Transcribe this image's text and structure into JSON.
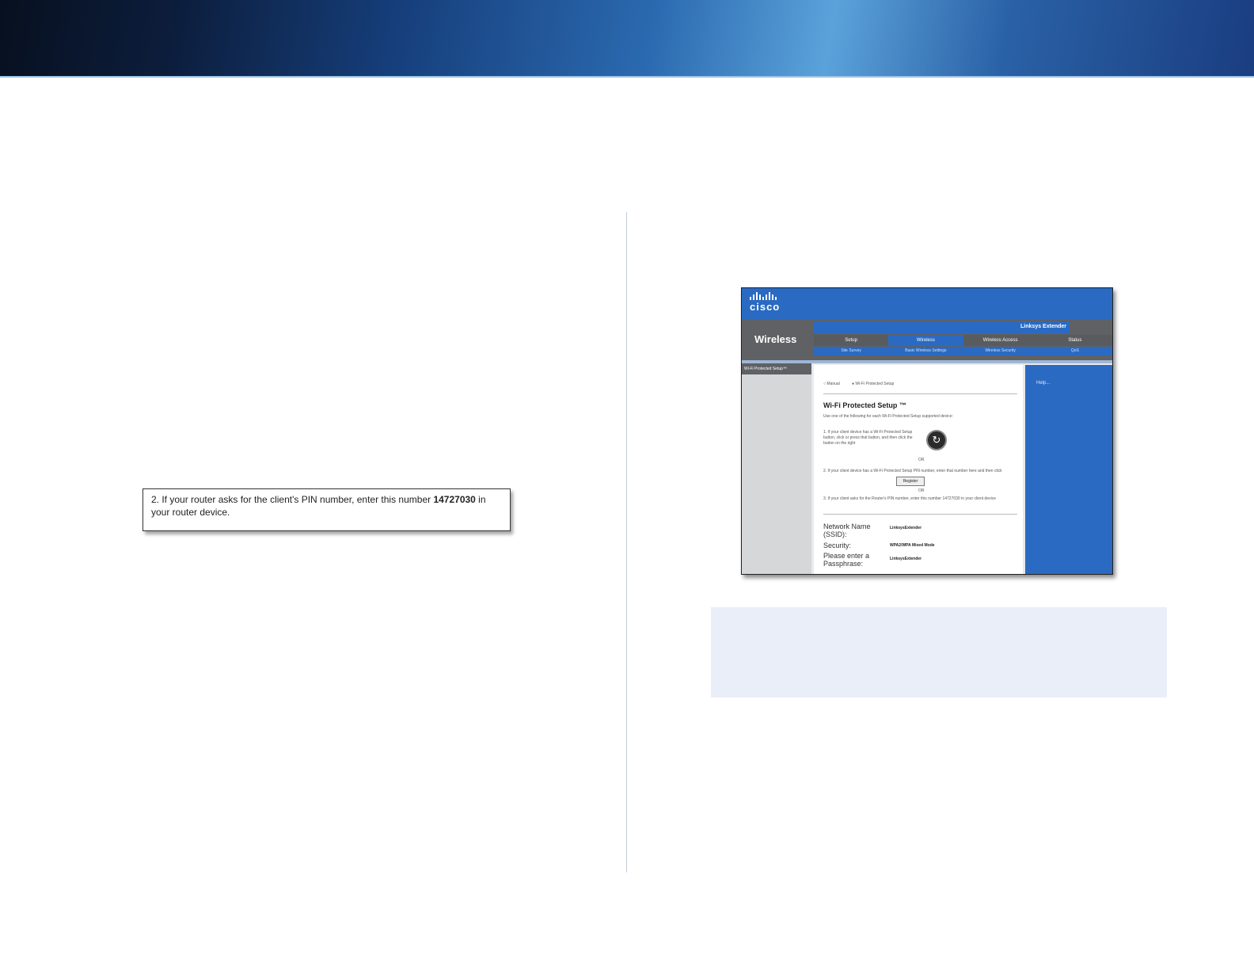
{
  "pin_note": {
    "prefix": "2. If your router asks for the client's PIN number, enter this number ",
    "pin": "14727030",
    "suffix": " in your router device."
  },
  "screenshot": {
    "brand": "cisco",
    "section": "Wireless",
    "product": "Linksys Extender",
    "tabs": [
      "Setup",
      "Wireless",
      "Wireless Access",
      "Status"
    ],
    "subtabs": [
      "Site Survey",
      "Basic Wireless Settings",
      "Wireless Security",
      "QoS"
    ],
    "left_heading": "Wi-Fi Protected Setup™",
    "mode_manual": "Manual",
    "mode_wps": "Wi-Fi Protected Setup",
    "title": "Wi-Fi Protected Setup ™",
    "intro": "Use one of the following for each Wi-Fi Protected Setup supported device:",
    "step1": "1. If your client device has a Wi-Fi Protected Setup button, click or press that button, and then click the button on the right",
    "or": "OR",
    "step2": "2. If your client device has a Wi-Fi Protected Setup PIN number, enter that number here and then click",
    "register_button": "Register",
    "step3": "3. If your client asks for the Router's PIN number, enter this number 14727030 in your client device",
    "fields": [
      {
        "label": "Network Name (SSID):",
        "value": "LinksysExtender"
      },
      {
        "label": "Security:",
        "value": "WPA2/WPA Mixed Mode"
      },
      {
        "label": "Please enter a Passphrase:",
        "value": "LinksysExtender"
      }
    ],
    "help_label": "Help..."
  }
}
